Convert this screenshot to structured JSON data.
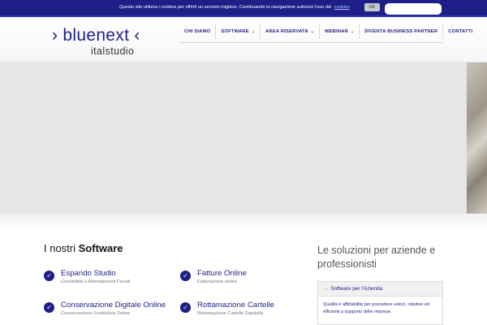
{
  "cookie_bar": {
    "text": "Questo sito utilizza i cookies per offrirti un servizio migliore. Continuando la navigazione autorizzi l'uso dei",
    "link": "cookies",
    "ok": "OK"
  },
  "logo": {
    "main": "› bluenext ‹",
    "sub": "italstudio"
  },
  "nav": [
    {
      "label": "CHI SIAMO",
      "dropdown": false
    },
    {
      "label": "SOFTWARE",
      "dropdown": true
    },
    {
      "label": "AREA RISERVATA",
      "dropdown": true
    },
    {
      "label": "WEBINAR",
      "dropdown": true
    },
    {
      "label": "DIVENTA BUSINESS PARTNER",
      "dropdown": false
    },
    {
      "label": "CONTATTI",
      "dropdown": false
    }
  ],
  "software": {
    "title_prefix": "I nostri",
    "title_bold": "Software",
    "items": [
      {
        "name": "Espando Studio",
        "desc": "Contabilità e Adempimenti Fiscali"
      },
      {
        "name": "Fatture Online",
        "desc": "Fatturazione online"
      },
      {
        "name": "Conservazione Digitale Online",
        "desc": "Conservazione Sostitutiva Online"
      },
      {
        "name": "Rottamazione Cartelle",
        "desc": "Rottamazione Cartelle Equitalia"
      }
    ]
  },
  "solutions": {
    "title": "Le soluzioni per aziende e professionisti",
    "tab": "Software per l'Azienda",
    "text": "Qualità e affidabilità per procedure veloci, intuitive ed efficienti a supporto delle imprese."
  },
  "colors": {
    "brand": "#1d1f87",
    "accent": "#2b33b7",
    "hero_bg": "#e6e6e6"
  }
}
